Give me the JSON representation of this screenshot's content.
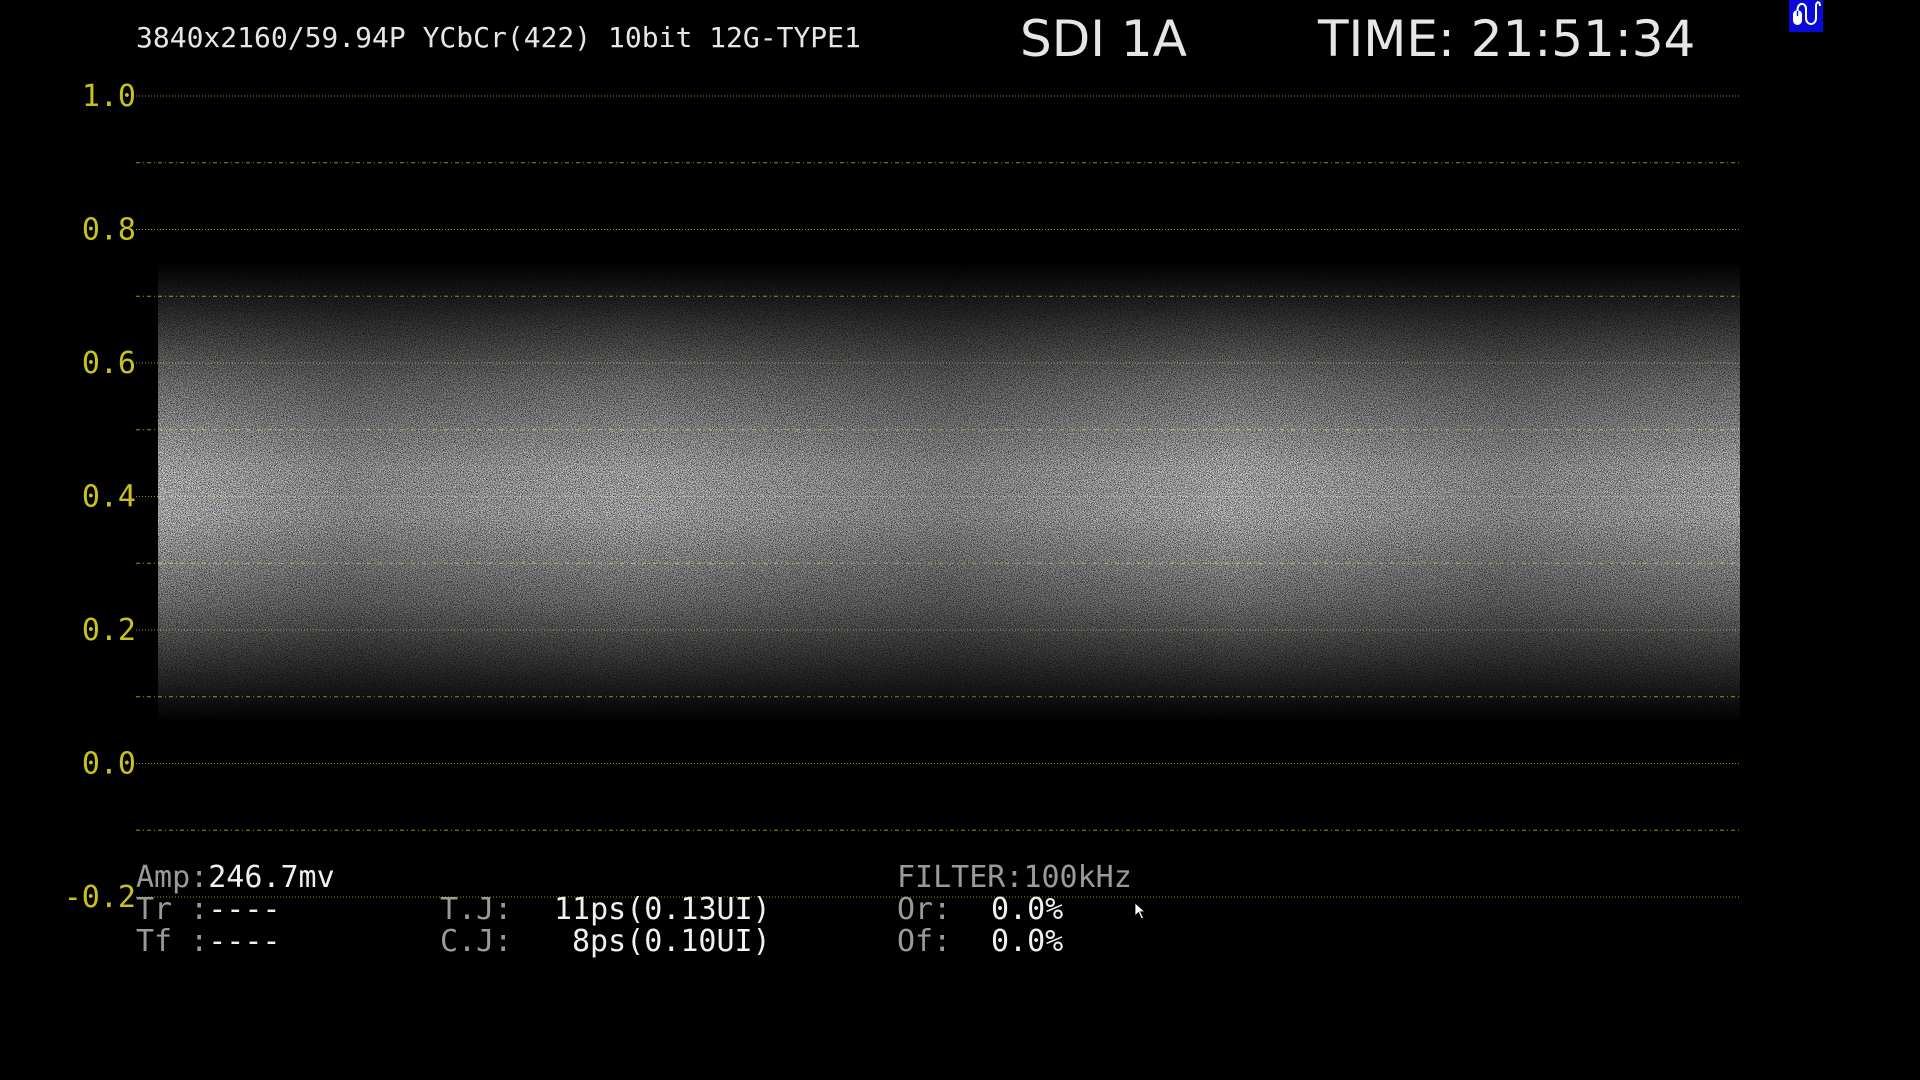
{
  "header": {
    "format": "3840x2160/59.94P YCbCr(422) 10bit 12G-TYPE1",
    "input": "SDI 1A",
    "time_label": "TIME:",
    "time_value": "21:51:34"
  },
  "icons": {
    "mouse_indicator": "mouse-icon",
    "pointer": "cursor-arrow-icon"
  },
  "colors": {
    "background": "#000000",
    "scale": "#c8c21a",
    "text": "#e6e6e6",
    "label": "#9a9a9a",
    "badge": "#0a0ad8"
  },
  "scope": {
    "y_ticks": [
      "1.0",
      "0.8",
      "0.6",
      "0.4",
      "0.2",
      "0.0",
      "-0.2"
    ],
    "grid": true
  },
  "measurements": {
    "amp_label": "Amp:",
    "amp_value": "246.7mv",
    "tr_label": "Tr :",
    "tr_value": "----",
    "tf_label": "Tf :",
    "tf_value": "----",
    "tj_label": "T.J:",
    "tj_value": "11ps(0.13UI)",
    "cj_label": "C.J:",
    "cj_value": "8ps(0.10UI)",
    "filter_label": "FILTER:",
    "filter_value": "100kHz",
    "or_label": "Or:",
    "or_value": "0.0%",
    "of_label": "Of:",
    "of_value": "0.0%"
  }
}
